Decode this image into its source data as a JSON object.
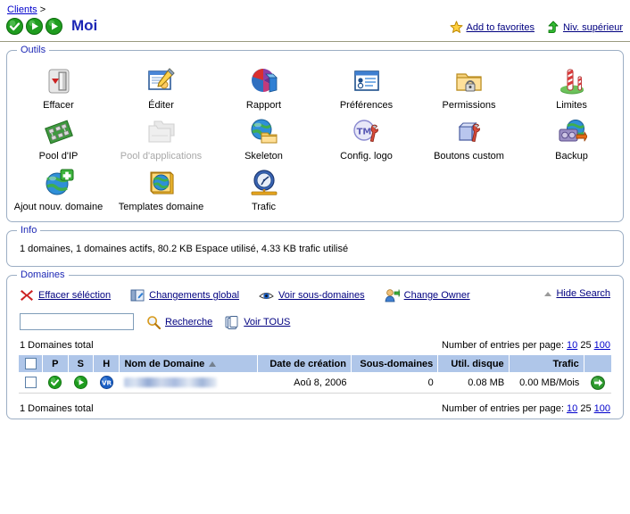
{
  "header": {
    "breadcrumb_link": "Clients",
    "breadcrumb_sep": ">",
    "title": "Moi",
    "status_icons": [
      "check-circle-icon",
      "play-circle-icon",
      "play-circle-icon"
    ],
    "favorites_label": "Add to favorites",
    "favorites_icon": "star-icon",
    "up_level_label": "Niv. supérieur",
    "up_level_icon": "up-arrow-icon"
  },
  "tools_panel": {
    "legend": "Outils",
    "items": [
      {
        "label": "Effacer",
        "icon": "eraser-icon",
        "disabled": false
      },
      {
        "label": "Éditer",
        "icon": "edit-card-icon",
        "disabled": false
      },
      {
        "label": "Rapport",
        "icon": "pie-chart-icon",
        "disabled": false
      },
      {
        "label": "Préférences",
        "icon": "preferences-window-icon",
        "disabled": false
      },
      {
        "label": "Permissions",
        "icon": "folder-lock-icon",
        "disabled": false
      },
      {
        "label": "Limites",
        "icon": "barrier-pole-icon",
        "disabled": false
      },
      {
        "label": "Pool d'IP",
        "icon": "network-chip-icon",
        "disabled": false
      },
      {
        "label": "Pool d'applications",
        "icon": "folders-stack-icon",
        "disabled": true
      },
      {
        "label": "Skeleton",
        "icon": "globe-folder-icon",
        "disabled": false
      },
      {
        "label": "Config. logo",
        "icon": "tm-wrench-icon",
        "disabled": false
      },
      {
        "label": "Boutons custom",
        "icon": "button-wrench-icon",
        "disabled": false
      },
      {
        "label": "Backup",
        "icon": "backup-disk-icon",
        "disabled": false
      },
      {
        "label": "Ajout nouv. domaine",
        "icon": "globe-plus-icon",
        "disabled": false
      },
      {
        "label": "Templates domaine",
        "icon": "globe-template-icon",
        "disabled": false
      },
      {
        "label": "Trafic",
        "icon": "clock-traffic-icon",
        "disabled": false
      }
    ]
  },
  "info_panel": {
    "legend": "Info",
    "text": "1 domaines, 1 domaines actifs, 80.2 KB Espace utilisé, 4.33 KB trafic utilisé"
  },
  "domains_panel": {
    "legend": "Domaines",
    "actions": [
      {
        "label": "Effacer séléction",
        "icon": "red-x-icon"
      },
      {
        "label": "Changements global",
        "icon": "global-changes-icon"
      },
      {
        "label": "Voir sous-domaines",
        "icon": "eye-icon"
      },
      {
        "label": "Change Owner",
        "icon": "user-swap-icon"
      }
    ],
    "hide_search": {
      "label": "Hide Search",
      "icon": "triangle-up-icon"
    },
    "search": {
      "value": "",
      "placeholder": "",
      "search_label": "Recherche",
      "search_icon": "magnifier-icon",
      "view_all_label": "Voir TOUS",
      "view_all_icon": "pages-icon"
    },
    "totals_top": "1 Domaines total",
    "totals_bottom": "1 Domaines total",
    "entries_label": "Number of entries per page:",
    "entries_options": [
      "10",
      "25",
      "100"
    ],
    "entries_selected": "25",
    "table": {
      "columns": [
        {
          "key": "checkbox",
          "label": "",
          "align": "center"
        },
        {
          "key": "p",
          "label": "P",
          "align": "center"
        },
        {
          "key": "s",
          "label": "S",
          "align": "center"
        },
        {
          "key": "h",
          "label": "H",
          "align": "center"
        },
        {
          "key": "name",
          "label": "Nom de Domaine",
          "align": "left",
          "sorted": "asc"
        },
        {
          "key": "created",
          "label": "Date de création",
          "align": "right"
        },
        {
          "key": "subdomains",
          "label": "Sous-domaines",
          "align": "right"
        },
        {
          "key": "disk",
          "label": "Util. disque",
          "align": "right"
        },
        {
          "key": "traffic",
          "label": "Trafic",
          "align": "right"
        },
        {
          "key": "go",
          "label": "",
          "align": "center"
        }
      ],
      "rows": [
        {
          "checked": false,
          "p_icon": "green-check-icon",
          "s_icon": "green-play-icon",
          "h_icon": "blue-vr-icon",
          "name": "",
          "name_redacted": true,
          "created": "Aoû 8, 2006",
          "subdomains": "0",
          "disk": "0.08 MB",
          "traffic": "0.00 MB/Mois",
          "go_icon": "green-arrow-globe-icon"
        }
      ]
    }
  },
  "colors": {
    "header_blue": "#afc6e9",
    "title_blue": "#1c27b5",
    "link_blue": "#000080",
    "panel_border": "#9caec4",
    "green": "#1a9e1a"
  }
}
